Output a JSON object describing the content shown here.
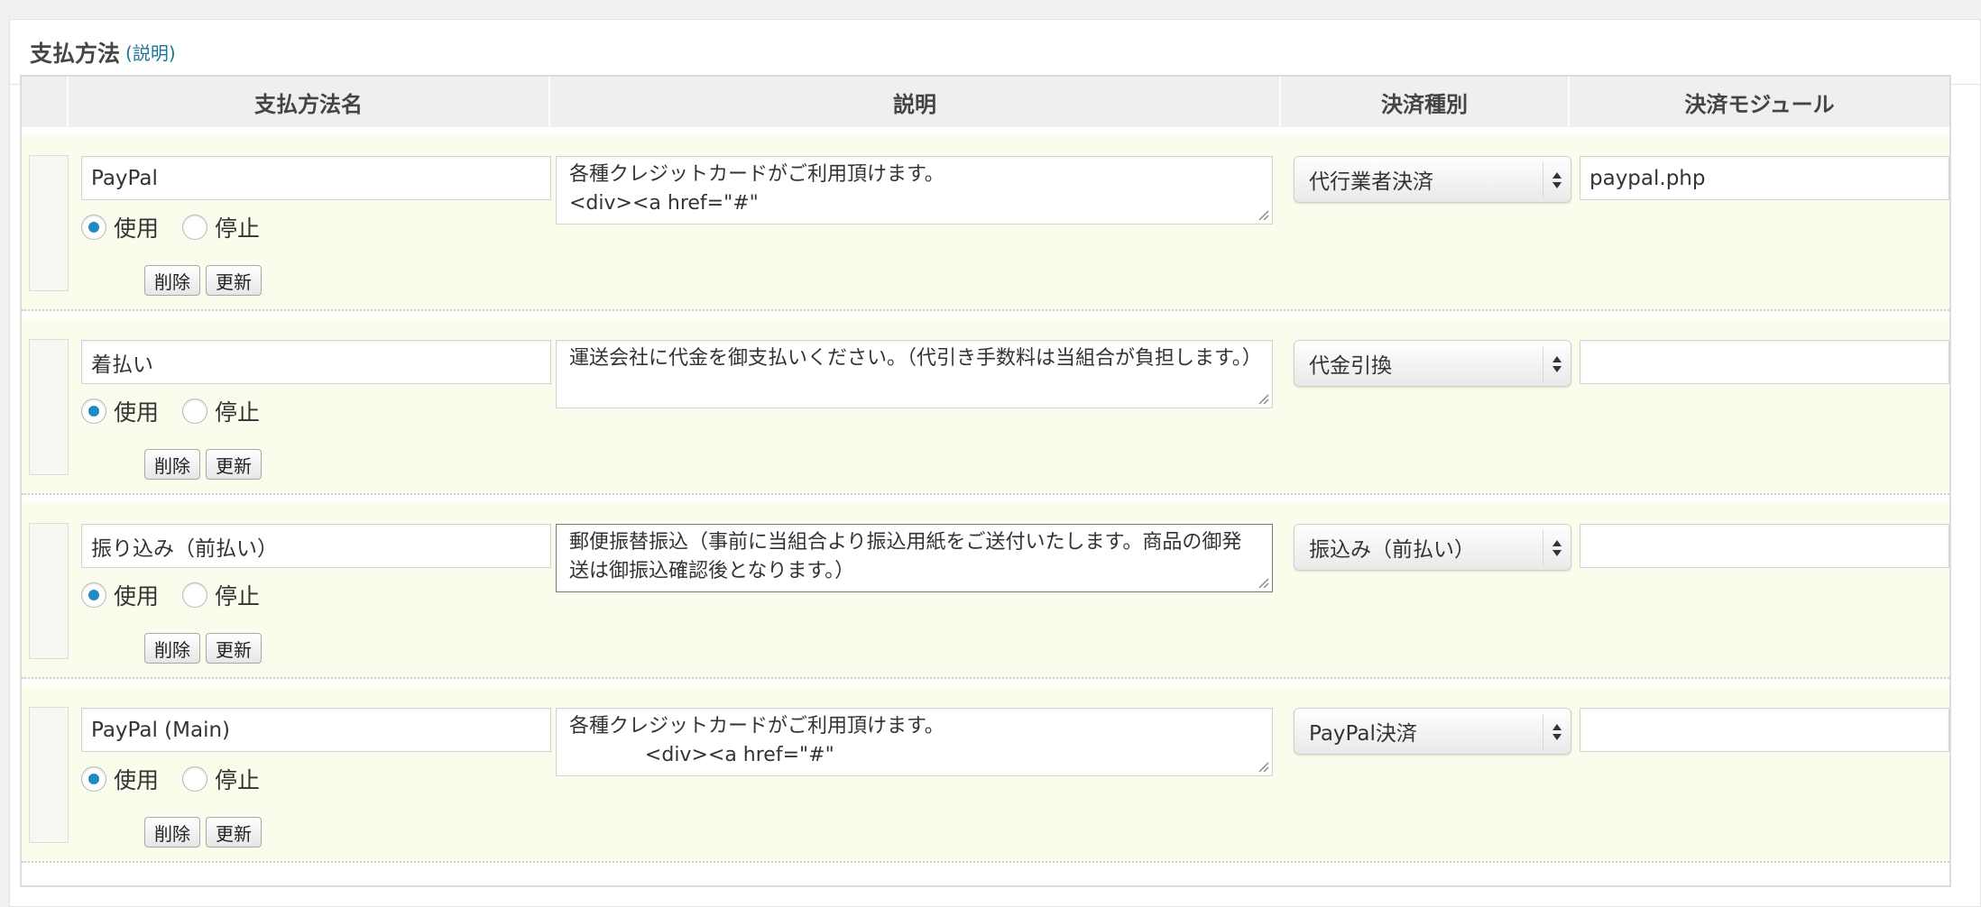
{
  "panel": {
    "title": "支払方法",
    "help_link": "(説明)"
  },
  "table": {
    "headers": [
      "",
      "支払方法名",
      "説明",
      "決済種別",
      "決済モジュール"
    ]
  },
  "radio_labels": {
    "use": "使用",
    "stop": "停止"
  },
  "button_labels": {
    "delete": "削除",
    "update": "更新"
  },
  "rows": [
    {
      "name": "PayPal",
      "status": "use",
      "description": "各種クレジットカードがご利用頂けます。\n<div><a href=\"#\"",
      "settlement_type": "代行業者決済",
      "module": "paypal.php"
    },
    {
      "name": "着払い",
      "status": "use",
      "description": "運送会社に代金を御支払いください。（代引き手数料は当組合が負担します。）",
      "settlement_type": "代金引換",
      "module": ""
    },
    {
      "name": "振り込み（前払い）",
      "status": "use",
      "description": "郵便振替振込（事前に当組合より振込用紙をご送付いたします。商品の御発送は御振込確認後となります。）",
      "settlement_type": "振込み（前払い）",
      "module": ""
    },
    {
      "name": "PayPal (Main)",
      "status": "use",
      "description": "各種クレジットカードがご利用頂けます。\n            <div><a href=\"#\"",
      "settlement_type": "PayPal決済",
      "module": ""
    }
  ],
  "colors": {
    "row_background": "#fbfdec",
    "header_background": "#efefef",
    "radio_selected": "#1e8cbe",
    "link": "#21759b"
  }
}
